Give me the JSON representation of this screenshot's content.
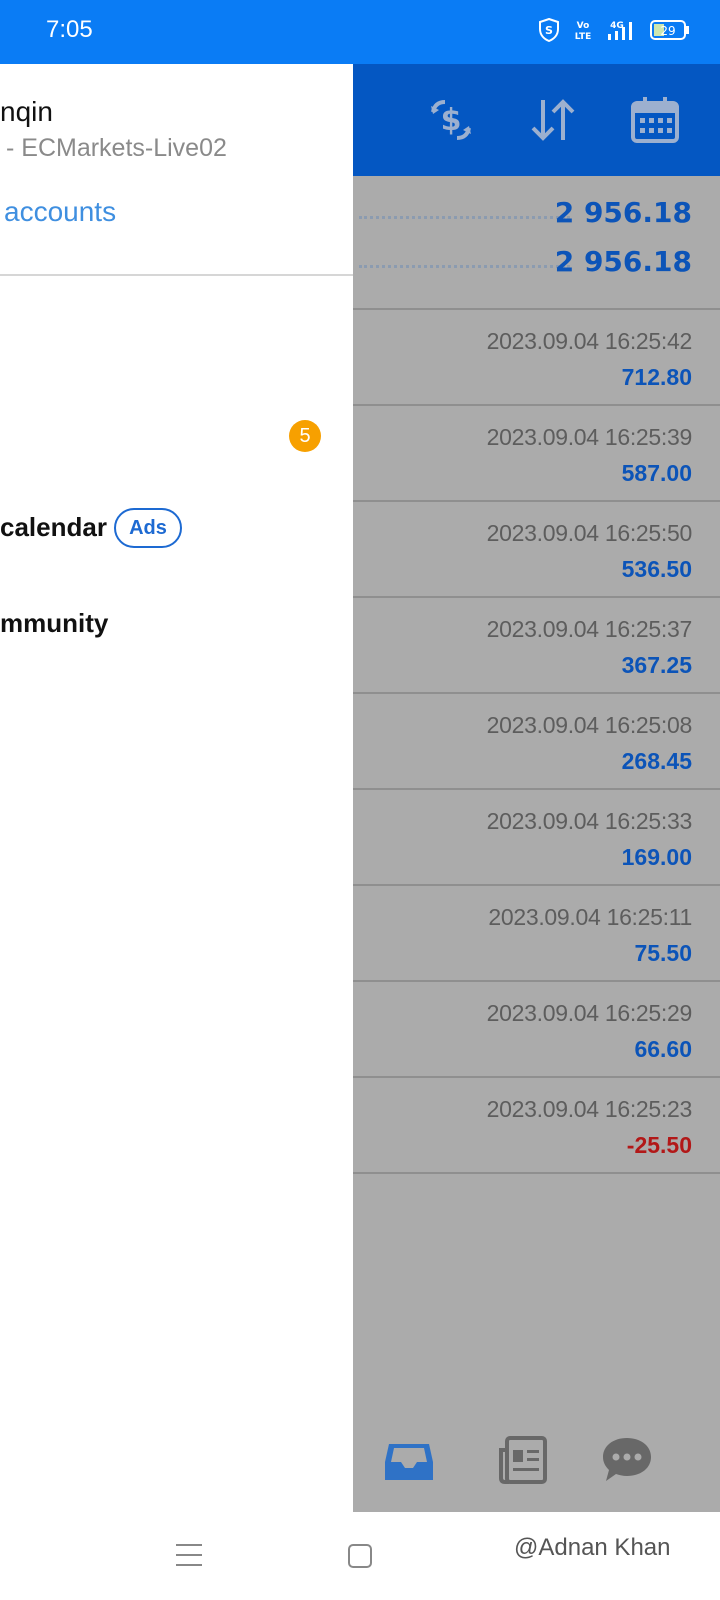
{
  "status_bar": {
    "time": "7:05",
    "icons": [
      "shield-s-icon",
      "volte-icon",
      "signal-4g-icon",
      "battery-icon"
    ],
    "volte": "Vo LTE",
    "network": "4G",
    "battery": "29"
  },
  "drawer": {
    "account_name": "nqin",
    "server": "- ECMarkets-Live02",
    "manage_accounts": "accounts",
    "badge_count": "5",
    "menu": [
      {
        "label": "calendar",
        "tag": "Ads"
      },
      {
        "label": "mmunity"
      }
    ]
  },
  "toolbar": {
    "icons": [
      "currency-exchange-icon",
      "sort-icon",
      "calendar-icon"
    ]
  },
  "summary": [
    "2 956.18",
    "2 956.18"
  ],
  "deals": [
    {
      "datetime": "2023.09.04 16:25:42",
      "profit": "712.80"
    },
    {
      "datetime": "2023.09.04 16:25:39",
      "profit": "587.00"
    },
    {
      "datetime": "2023.09.04 16:25:50",
      "profit": "536.50"
    },
    {
      "datetime": "2023.09.04 16:25:37",
      "profit": "367.25"
    },
    {
      "datetime": "2023.09.04 16:25:08",
      "profit": "268.45"
    },
    {
      "datetime": "2023.09.04 16:25:33",
      "profit": "169.00"
    },
    {
      "datetime": "2023.09.04 16:25:11",
      "profit": "75.50"
    },
    {
      "datetime": "2023.09.04 16:25:29",
      "profit": "66.60"
    },
    {
      "datetime": "2023.09.04 16:25:23",
      "profit": "-25.50"
    }
  ],
  "bottom_nav": [
    "inbox-icon",
    "news-icon",
    "chat-icon"
  ],
  "watermark": "@Adnan Khan",
  "colors": {
    "status_bar": "#0a7cf5",
    "toolbar": "#0457c2",
    "positive": "#0c54b8",
    "negative": "#b21818",
    "badge": "#f7a000"
  }
}
